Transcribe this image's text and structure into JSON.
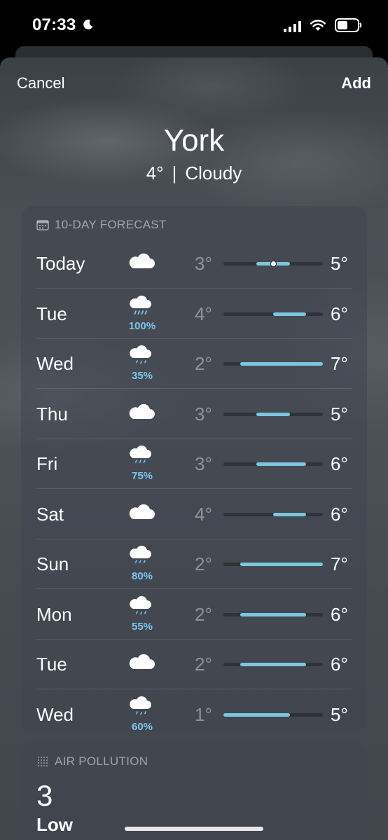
{
  "status_bar": {
    "time": "07:33"
  },
  "header": {
    "cancel_label": "Cancel",
    "add_label": "Add"
  },
  "location": {
    "city": "York",
    "current_temp": "4°",
    "separator": "|",
    "condition": "Cloudy"
  },
  "forecast": {
    "title": "10-DAY FORECAST",
    "range_min": 1,
    "range_max": 7,
    "days": [
      {
        "day": "Today",
        "icon": "cloud-icon",
        "precip": "",
        "low": "3°",
        "high": "5°",
        "low_val": 3,
        "high_val": 5,
        "current": 4
      },
      {
        "day": "Tue",
        "icon": "rain-icon",
        "precip": "100%",
        "low": "4°",
        "high": "6°",
        "low_val": 4,
        "high_val": 6
      },
      {
        "day": "Wed",
        "icon": "drizzle-icon",
        "precip": "35%",
        "low": "2°",
        "high": "7°",
        "low_val": 2,
        "high_val": 7
      },
      {
        "day": "Thu",
        "icon": "cloud-icon",
        "precip": "",
        "low": "3°",
        "high": "5°",
        "low_val": 3,
        "high_val": 5
      },
      {
        "day": "Fri",
        "icon": "sleet-icon",
        "precip": "75%",
        "low": "3°",
        "high": "6°",
        "low_val": 3,
        "high_val": 6
      },
      {
        "day": "Sat",
        "icon": "cloud-icon",
        "precip": "",
        "low": "4°",
        "high": "6°",
        "low_val": 4,
        "high_val": 6
      },
      {
        "day": "Sun",
        "icon": "sleet-icon",
        "precip": "80%",
        "low": "2°",
        "high": "7°",
        "low_val": 2,
        "high_val": 7
      },
      {
        "day": "Mon",
        "icon": "drizzle-icon",
        "precip": "55%",
        "low": "2°",
        "high": "6°",
        "low_val": 2,
        "high_val": 6
      },
      {
        "day": "Tue",
        "icon": "cloud-icon",
        "precip": "",
        "low": "2°",
        "high": "6°",
        "low_val": 2,
        "high_val": 6
      },
      {
        "day": "Wed",
        "icon": "drizzle-icon",
        "precip": "60%",
        "low": "1°",
        "high": "5°",
        "low_val": 1,
        "high_val": 5
      }
    ]
  },
  "air_pollution": {
    "title": "AIR POLLUTION",
    "index": "3",
    "level": "Low"
  },
  "colors": {
    "bar": "#7cc7e0",
    "precip_text": "#7cc7ee"
  }
}
